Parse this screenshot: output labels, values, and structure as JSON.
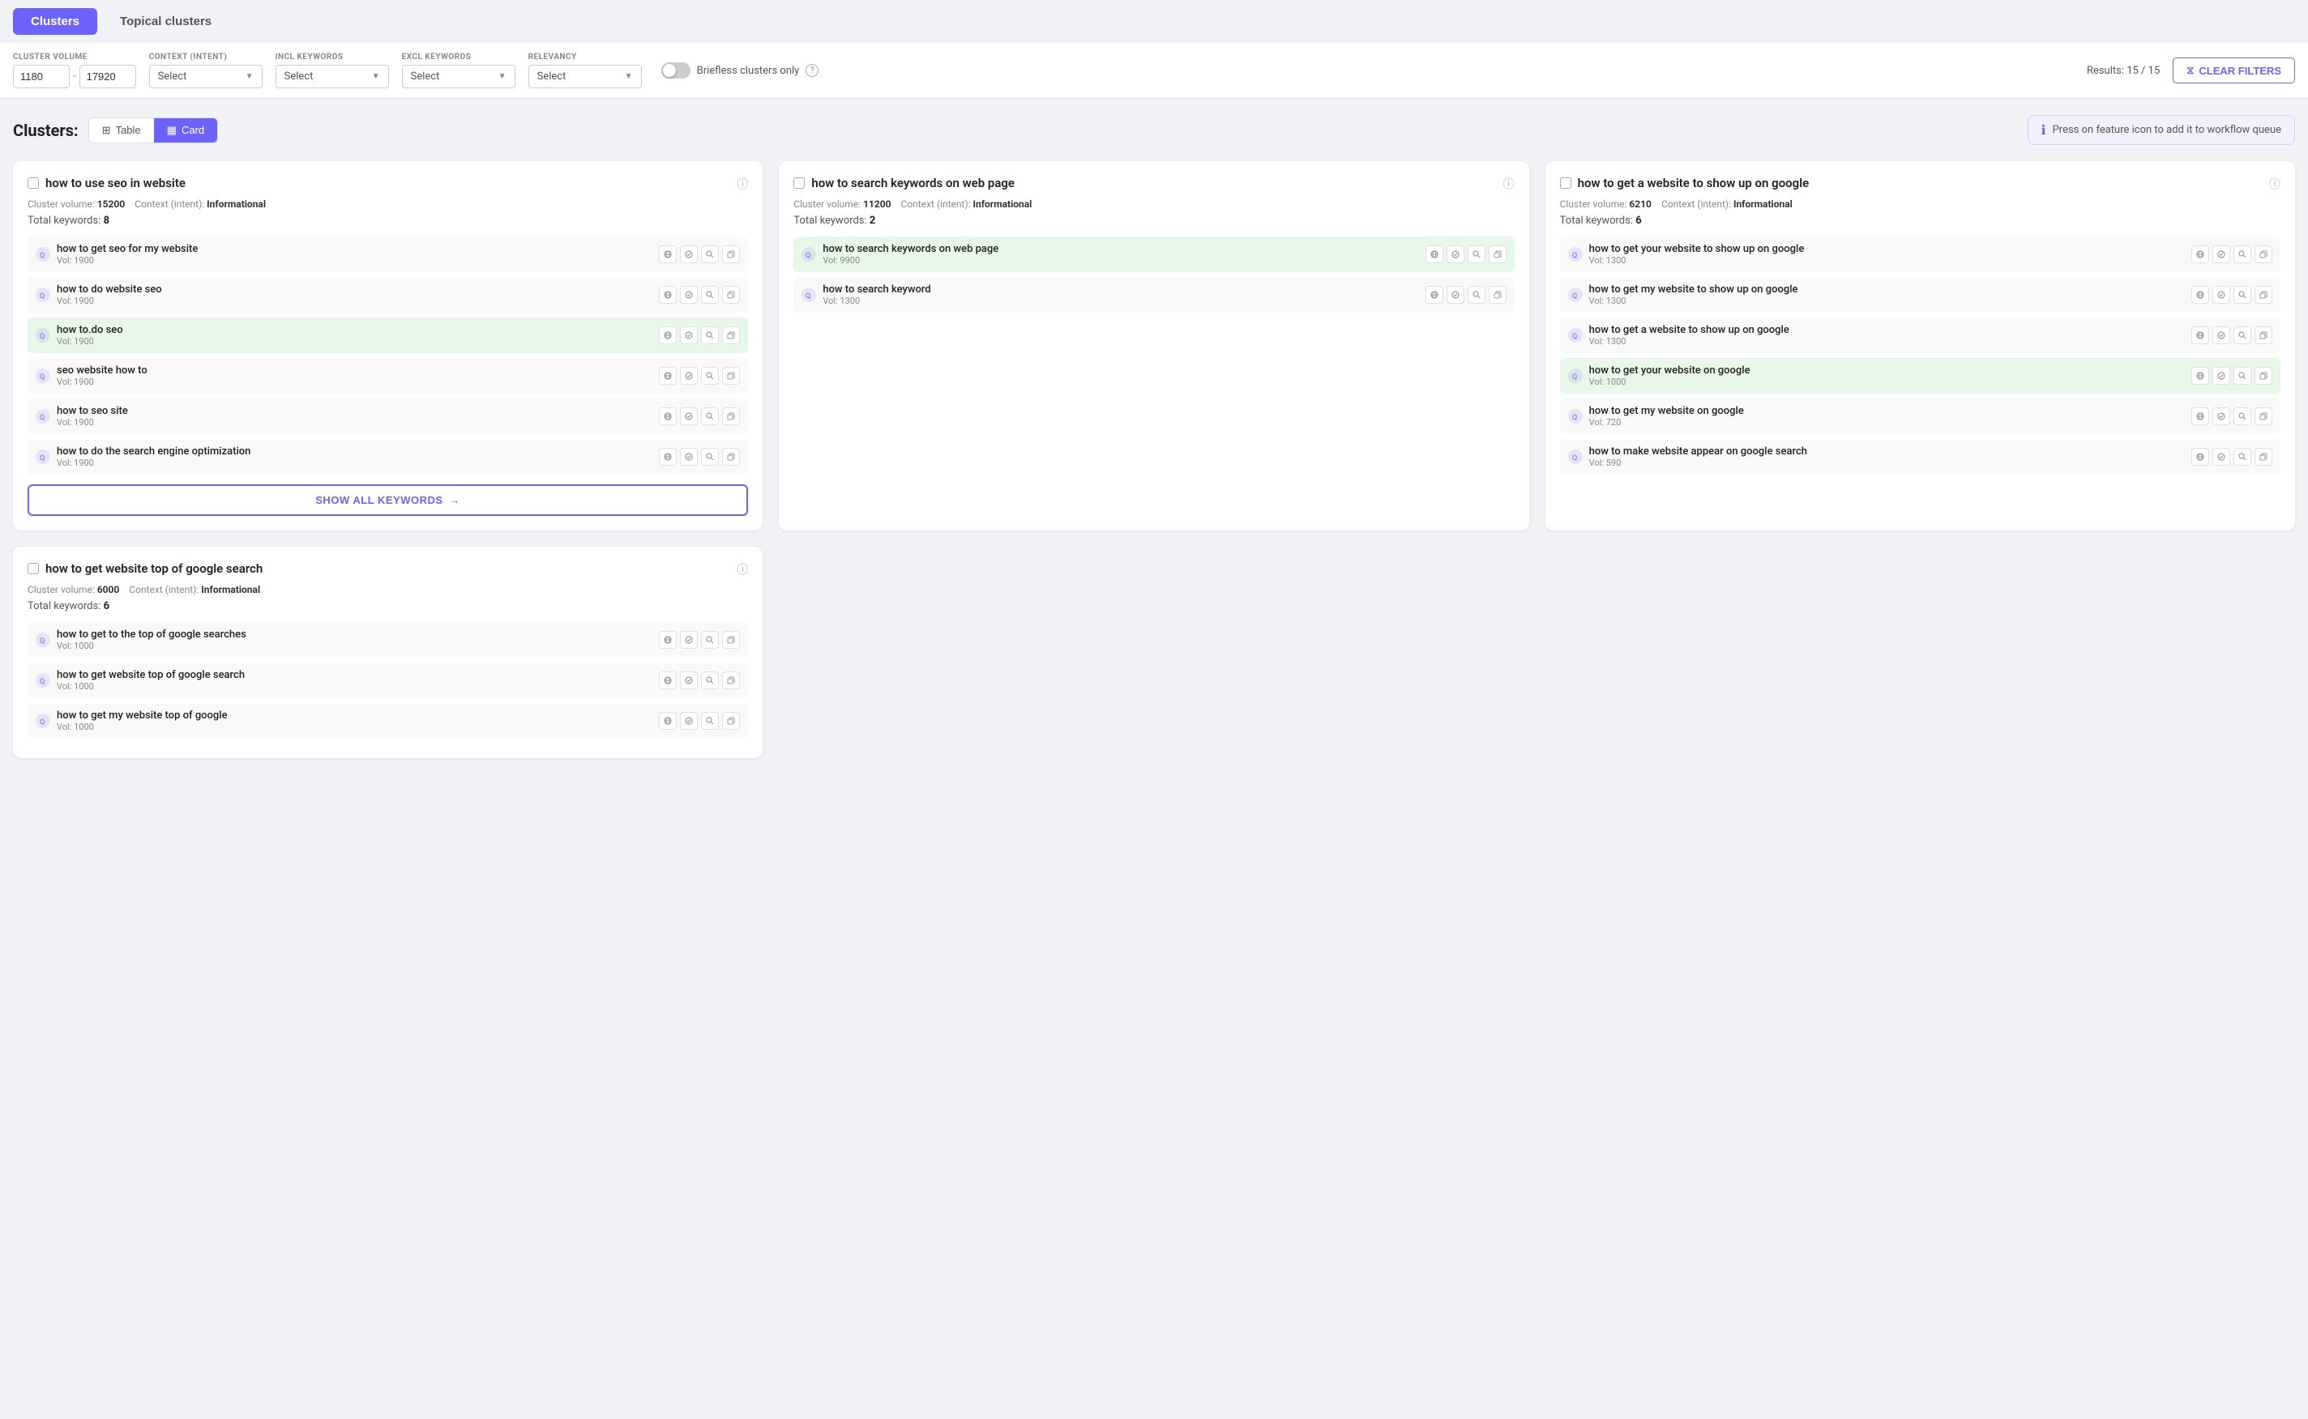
{
  "tabs": [
    {
      "id": "clusters",
      "label": "Clusters",
      "active": true
    },
    {
      "id": "topical-clusters",
      "label": "Topical clusters",
      "active": false
    }
  ],
  "filters": {
    "cluster_volume_label": "CLUSTER VOLUME",
    "volume_min": "1180",
    "volume_max": "17920",
    "volume_sep": "-",
    "context_intent_label": "CONTEXT (INTENT)",
    "context_placeholder": "Select",
    "incl_keywords_label": "INCL KEYWORDS",
    "incl_placeholder": "Select",
    "excl_keywords_label": "EXCL KEYWORDS",
    "excl_placeholder": "Select",
    "relevancy_label": "RELEVANCY",
    "relevancy_placeholder": "Select",
    "briefless_label": "Briefless clusters only",
    "results_label": "Results: 15 / 15",
    "clear_filters_label": "CLEAR FILTERS"
  },
  "clusters_section": {
    "title": "Clusters:",
    "table_btn": "Table",
    "card_btn": "Card",
    "info_text": "Press on feature icon to add it to workflow queue"
  },
  "cards": [
    {
      "id": "card1",
      "title": "how to use seo in website",
      "cluster_volume": "15200",
      "context_intent": "Informational",
      "total_keywords": "8",
      "keywords": [
        {
          "text": "how to get seo for my website",
          "vol": "1900",
          "highlighted": false
        },
        {
          "text": "how to do website seo",
          "vol": "1900",
          "highlighted": false
        },
        {
          "text": "how to.do seo",
          "vol": "1900",
          "highlighted": true
        },
        {
          "text": "seo website how to",
          "vol": "1900",
          "highlighted": false
        },
        {
          "text": "how to seo site",
          "vol": "1900",
          "highlighted": false
        },
        {
          "text": "how to do the search engine optimization",
          "vol": "1900",
          "highlighted": false
        }
      ],
      "show_all_label": "SHOW ALL KEYWORDS"
    },
    {
      "id": "card2",
      "title": "how to search keywords on web page",
      "cluster_volume": "11200",
      "context_intent": "Informational",
      "total_keywords": "2",
      "keywords": [
        {
          "text": "how to search keywords on web page",
          "vol": "9900",
          "highlighted": true
        },
        {
          "text": "how to search keyword",
          "vol": "1300",
          "highlighted": false
        }
      ],
      "show_all_label": null
    },
    {
      "id": "card3",
      "title": "how to get a website to show up on google",
      "cluster_volume": "6210",
      "context_intent": "Informational",
      "total_keywords": "6",
      "keywords": [
        {
          "text": "how to get your website to show up on google",
          "vol": "1300",
          "highlighted": false
        },
        {
          "text": "how to get my website to show up on google",
          "vol": "1300",
          "highlighted": false
        },
        {
          "text": "how to get a website to show up on google",
          "vol": "1300",
          "highlighted": false
        },
        {
          "text": "how to get your website on google",
          "vol": "1000",
          "highlighted": true
        },
        {
          "text": "how to get my website on google",
          "vol": "720",
          "highlighted": false
        },
        {
          "text": "how to make website appear on google search",
          "vol": "590",
          "highlighted": false
        }
      ],
      "show_all_label": null
    },
    {
      "id": "card4",
      "title": "how to get website top of google search",
      "cluster_volume": "6000",
      "context_intent": "Informational",
      "total_keywords": "6",
      "keywords": [
        {
          "text": "how to get to the top of google searches",
          "vol": "1000",
          "highlighted": false
        },
        {
          "text": "how to get website top of google search",
          "vol": "1000",
          "highlighted": false
        },
        {
          "text": "how to get my website top of google",
          "vol": "1000",
          "highlighted": false
        }
      ],
      "show_all_label": null
    }
  ]
}
